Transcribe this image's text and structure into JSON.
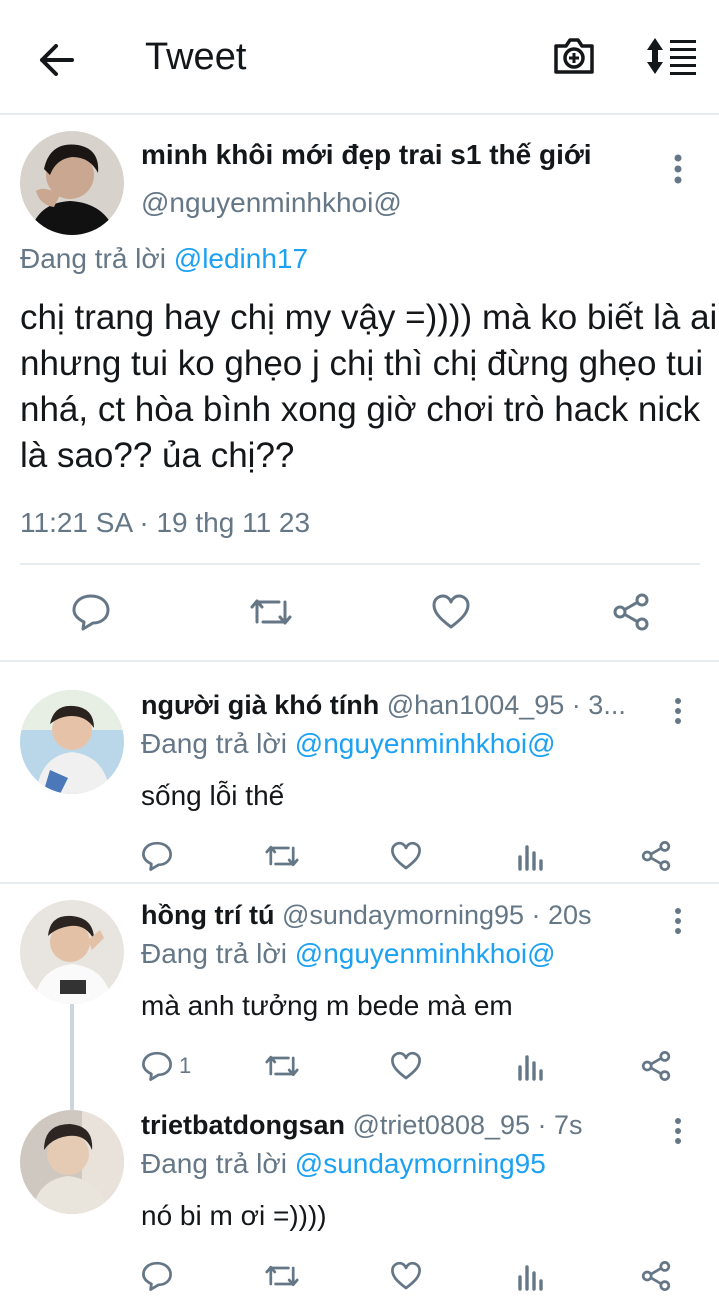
{
  "header": {
    "title": "Tweet"
  },
  "main_tweet": {
    "name": "minh khôi mới đẹp trai s1 thế giới",
    "handle": "@nguyenminhkhoi@",
    "replying_prefix": "Đang trả lời",
    "replying_to": "@ledinh17",
    "text": "chị trang hay chị my vậy =)))) mà ko biết là ai nhưng tui ko ghẹo j chị thì chị đừng ghẹo tui nhá, ct hòa bình xong giờ chơi trò hack nick là sao?? ủa chị??",
    "timestamp": "11:21 SA · 19 thg 11 23"
  },
  "replies": [
    {
      "name": "người già khó tính",
      "meta": " @han1004_95 · 3...",
      "replying_prefix": "Đang trả lời",
      "replying_to": "@nguyenminhkhoi@",
      "text": "sống lỗi thế",
      "reply_count": ""
    },
    {
      "name": "hồng trí tú",
      "meta": " @sundaymorning95 · 20s",
      "replying_prefix": "Đang trả lời",
      "replying_to": "@nguyenminhkhoi@",
      "text": "mà anh tưởng m bede mà em",
      "reply_count": "1"
    },
    {
      "name": "trietbatdongsan",
      "meta": " @triet0808_95 · 7s",
      "replying_prefix": "Đang trả lời",
      "replying_to": "@sundaymorning95",
      "text": "nó bi m ơi =))))",
      "reply_count": ""
    }
  ],
  "colors": {
    "accent": "#1da1f2",
    "icon": "#657786",
    "text": "#14171a",
    "divider": "#e6ecf0"
  }
}
